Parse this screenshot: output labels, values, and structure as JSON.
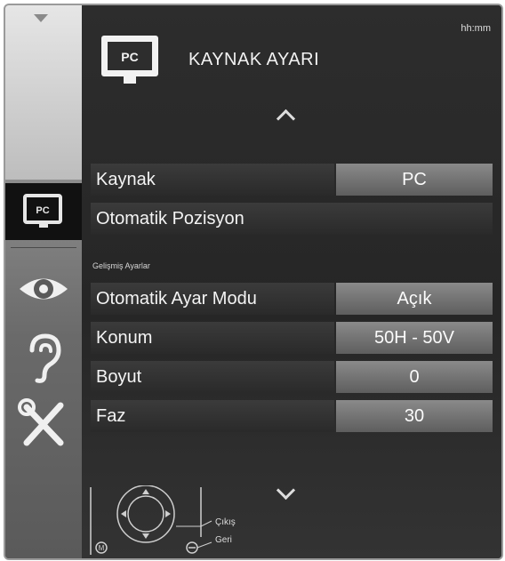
{
  "header": {
    "title": "KAYNAK AYARI",
    "clock": "hh:mm",
    "icon": "pc-icon",
    "icon_text": "PC"
  },
  "sidebar": {
    "items": [
      {
        "icon": "pc-icon",
        "label": "PC",
        "active": true
      },
      {
        "icon": "eye-icon"
      },
      {
        "icon": "ear-icon"
      },
      {
        "icon": "tools-icon"
      }
    ]
  },
  "menu": {
    "rows": [
      {
        "label": "Kaynak",
        "value": "PC"
      },
      {
        "label": "Otomatik Pozisyon"
      }
    ],
    "section_title": "Gelişmiş Ayarlar",
    "advanced_rows": [
      {
        "label": "Otomatik Ayar Modu",
        "value": "Açık"
      },
      {
        "label": "Konum",
        "value": "50H - 50V"
      },
      {
        "label": "Boyut",
        "value": "0"
      },
      {
        "label": "Faz",
        "value": "30"
      }
    ]
  },
  "footer": {
    "exit_label": "Çıkış",
    "back_label": "Geri",
    "menu_button": "M"
  }
}
